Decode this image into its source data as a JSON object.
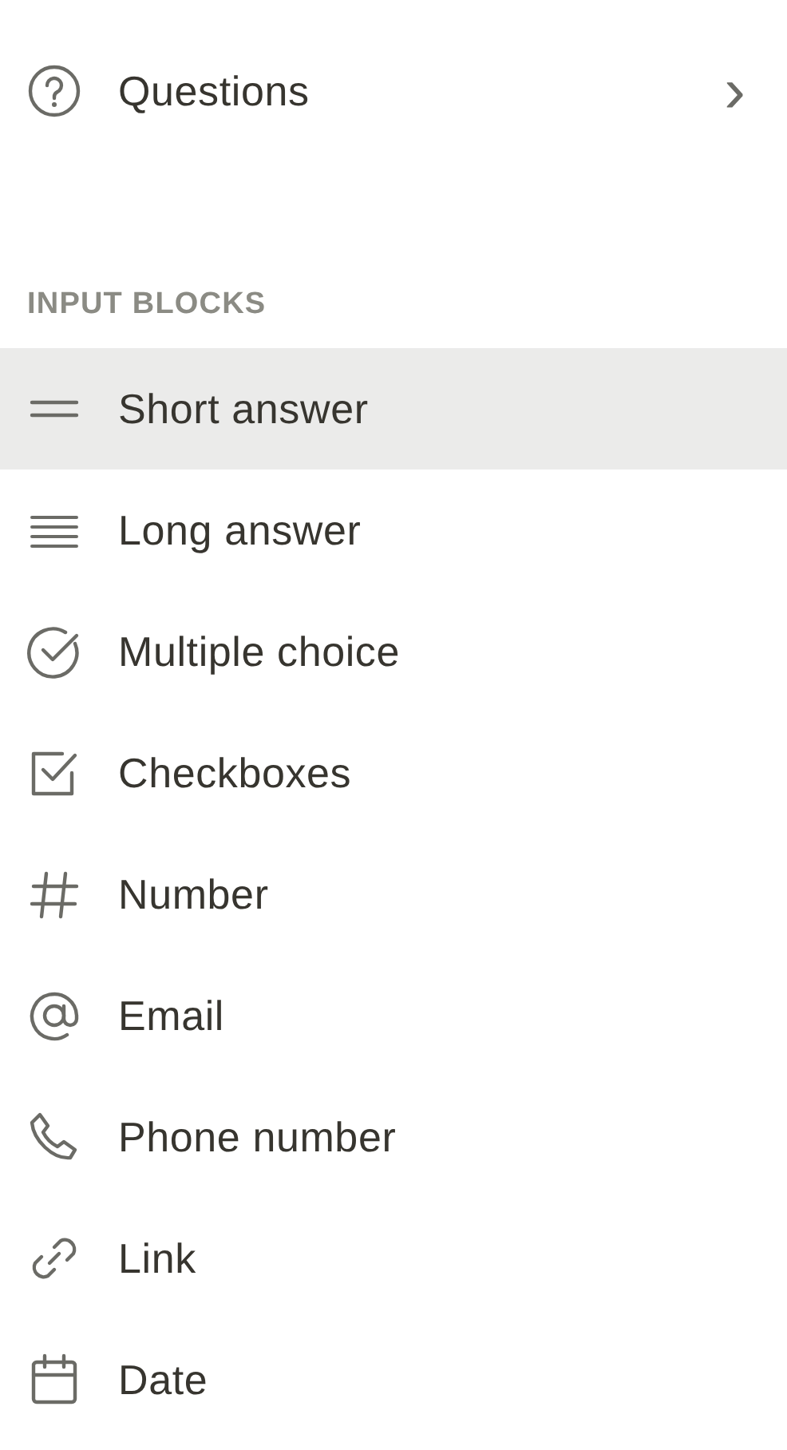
{
  "nav": {
    "label": "Questions",
    "chevron": "›"
  },
  "section": {
    "title": "INPUT BLOCKS"
  },
  "items": [
    {
      "kind": "short",
      "label": "Short answer",
      "selected": true
    },
    {
      "kind": "long",
      "label": "Long answer",
      "selected": false
    },
    {
      "kind": "choice",
      "label": "Multiple choice",
      "selected": false
    },
    {
      "kind": "checkbox",
      "label": "Checkboxes",
      "selected": false
    },
    {
      "kind": "number",
      "label": "Number",
      "selected": false
    },
    {
      "kind": "email",
      "label": "Email",
      "selected": false
    },
    {
      "kind": "phone",
      "label": "Phone number",
      "selected": false
    },
    {
      "kind": "link",
      "label": "Link",
      "selected": false
    },
    {
      "kind": "date",
      "label": "Date",
      "selected": false
    }
  ]
}
